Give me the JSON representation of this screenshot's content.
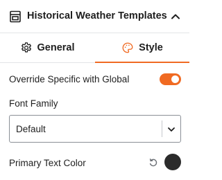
{
  "header": {
    "title": "Historical Weather Templates",
    "block_icon": "block-template-icon",
    "collapse_icon": "chevron-up-icon"
  },
  "tabs": [
    {
      "label": "General",
      "icon": "gear-icon",
      "active": false
    },
    {
      "label": "Style",
      "icon": "palette-icon",
      "active": true
    }
  ],
  "override": {
    "label": "Override Specific with Global",
    "enabled": true
  },
  "font_family": {
    "label": "Font Family",
    "selected": "Default"
  },
  "primary_text_color": {
    "label": "Primary Text Color",
    "value": "#2b2b2b",
    "reset_icon": "reset-icon"
  },
  "colors": {
    "accent": "#f06a22",
    "text": "#1e1e1e",
    "border": "#e2e4e7"
  }
}
